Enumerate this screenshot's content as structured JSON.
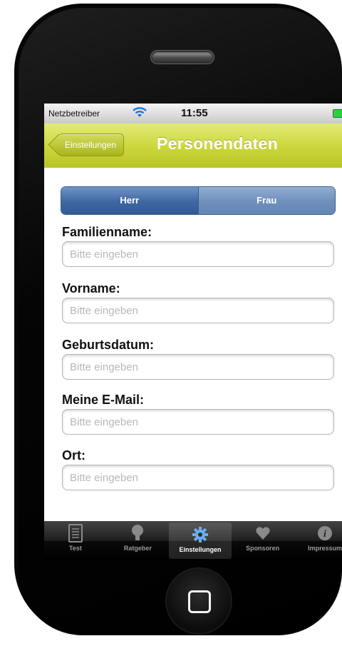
{
  "status_bar": {
    "carrier": "Netzbetreiber",
    "time": "11:55"
  },
  "nav": {
    "back_label": "Einstellungen",
    "title": "Personendaten"
  },
  "gender": {
    "options": [
      "Herr",
      "Frau"
    ],
    "selected": "Herr"
  },
  "fields": [
    {
      "label": "Familienname:",
      "placeholder": "Bitte eingeben",
      "value": ""
    },
    {
      "label": "Vorname:",
      "placeholder": "Bitte eingeben",
      "value": ""
    },
    {
      "label": "Geburtsdatum:",
      "placeholder": "Bitte eingeben",
      "value": ""
    },
    {
      "label": "Meine E-Mail:",
      "placeholder": "Bitte eingeben",
      "value": ""
    },
    {
      "label": "Ort:",
      "placeholder": "Bitte eingeben",
      "value": ""
    }
  ],
  "tabbar": {
    "items": [
      {
        "label": "Test",
        "icon": "document-icon"
      },
      {
        "label": "Ratgeber",
        "icon": "lightbulb-icon"
      },
      {
        "label": "Einstellungen",
        "icon": "gear-icon"
      },
      {
        "label": "Sponsoren",
        "icon": "heart-icon"
      },
      {
        "label": "Impressum",
        "icon": "info-icon"
      }
    ],
    "active": "Einstellungen"
  },
  "colors": {
    "navbar": "#cbd63a",
    "segment_active": "#3f67a1",
    "battery": "#2bd13c"
  }
}
